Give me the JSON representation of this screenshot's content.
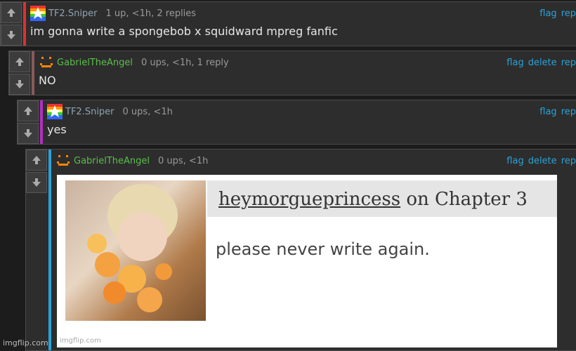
{
  "comments": [
    {
      "username": "TF2.Sniper",
      "meta": "1 up, <1h, 2 replies",
      "actions": [
        "flag",
        "rep"
      ],
      "body": "im gonna write a spongebob x squidward mpreg fanfic",
      "accent_color": "#e03030"
    },
    {
      "username": "GabrielTheAngel",
      "meta": "0 ups, <1h, 1 reply",
      "actions": [
        "flag",
        "delete",
        "rep"
      ],
      "body": "NO",
      "accent_color": "#8a5a5a"
    },
    {
      "username": "TF2.Sniper",
      "meta": "0 ups, <1h",
      "actions": [
        "flag",
        "rep"
      ],
      "body": "yes",
      "accent_color": "#b030c0"
    },
    {
      "username": "GabrielTheAngel",
      "meta": "0 ups, <1h",
      "actions": [
        "flag",
        "delete",
        "rep"
      ],
      "body": "",
      "accent_color": "#2aa3d8"
    }
  ],
  "meme": {
    "commenter": "heymorgueprincess",
    "title_suffix": " on Chapter 3",
    "text": "please never write again.",
    "watermark": "imgflip.com"
  },
  "footer": {
    "watermark": "imgflip.com"
  },
  "icons": {
    "upvote": "arrow-up-icon",
    "downvote": "arrow-down-icon"
  }
}
